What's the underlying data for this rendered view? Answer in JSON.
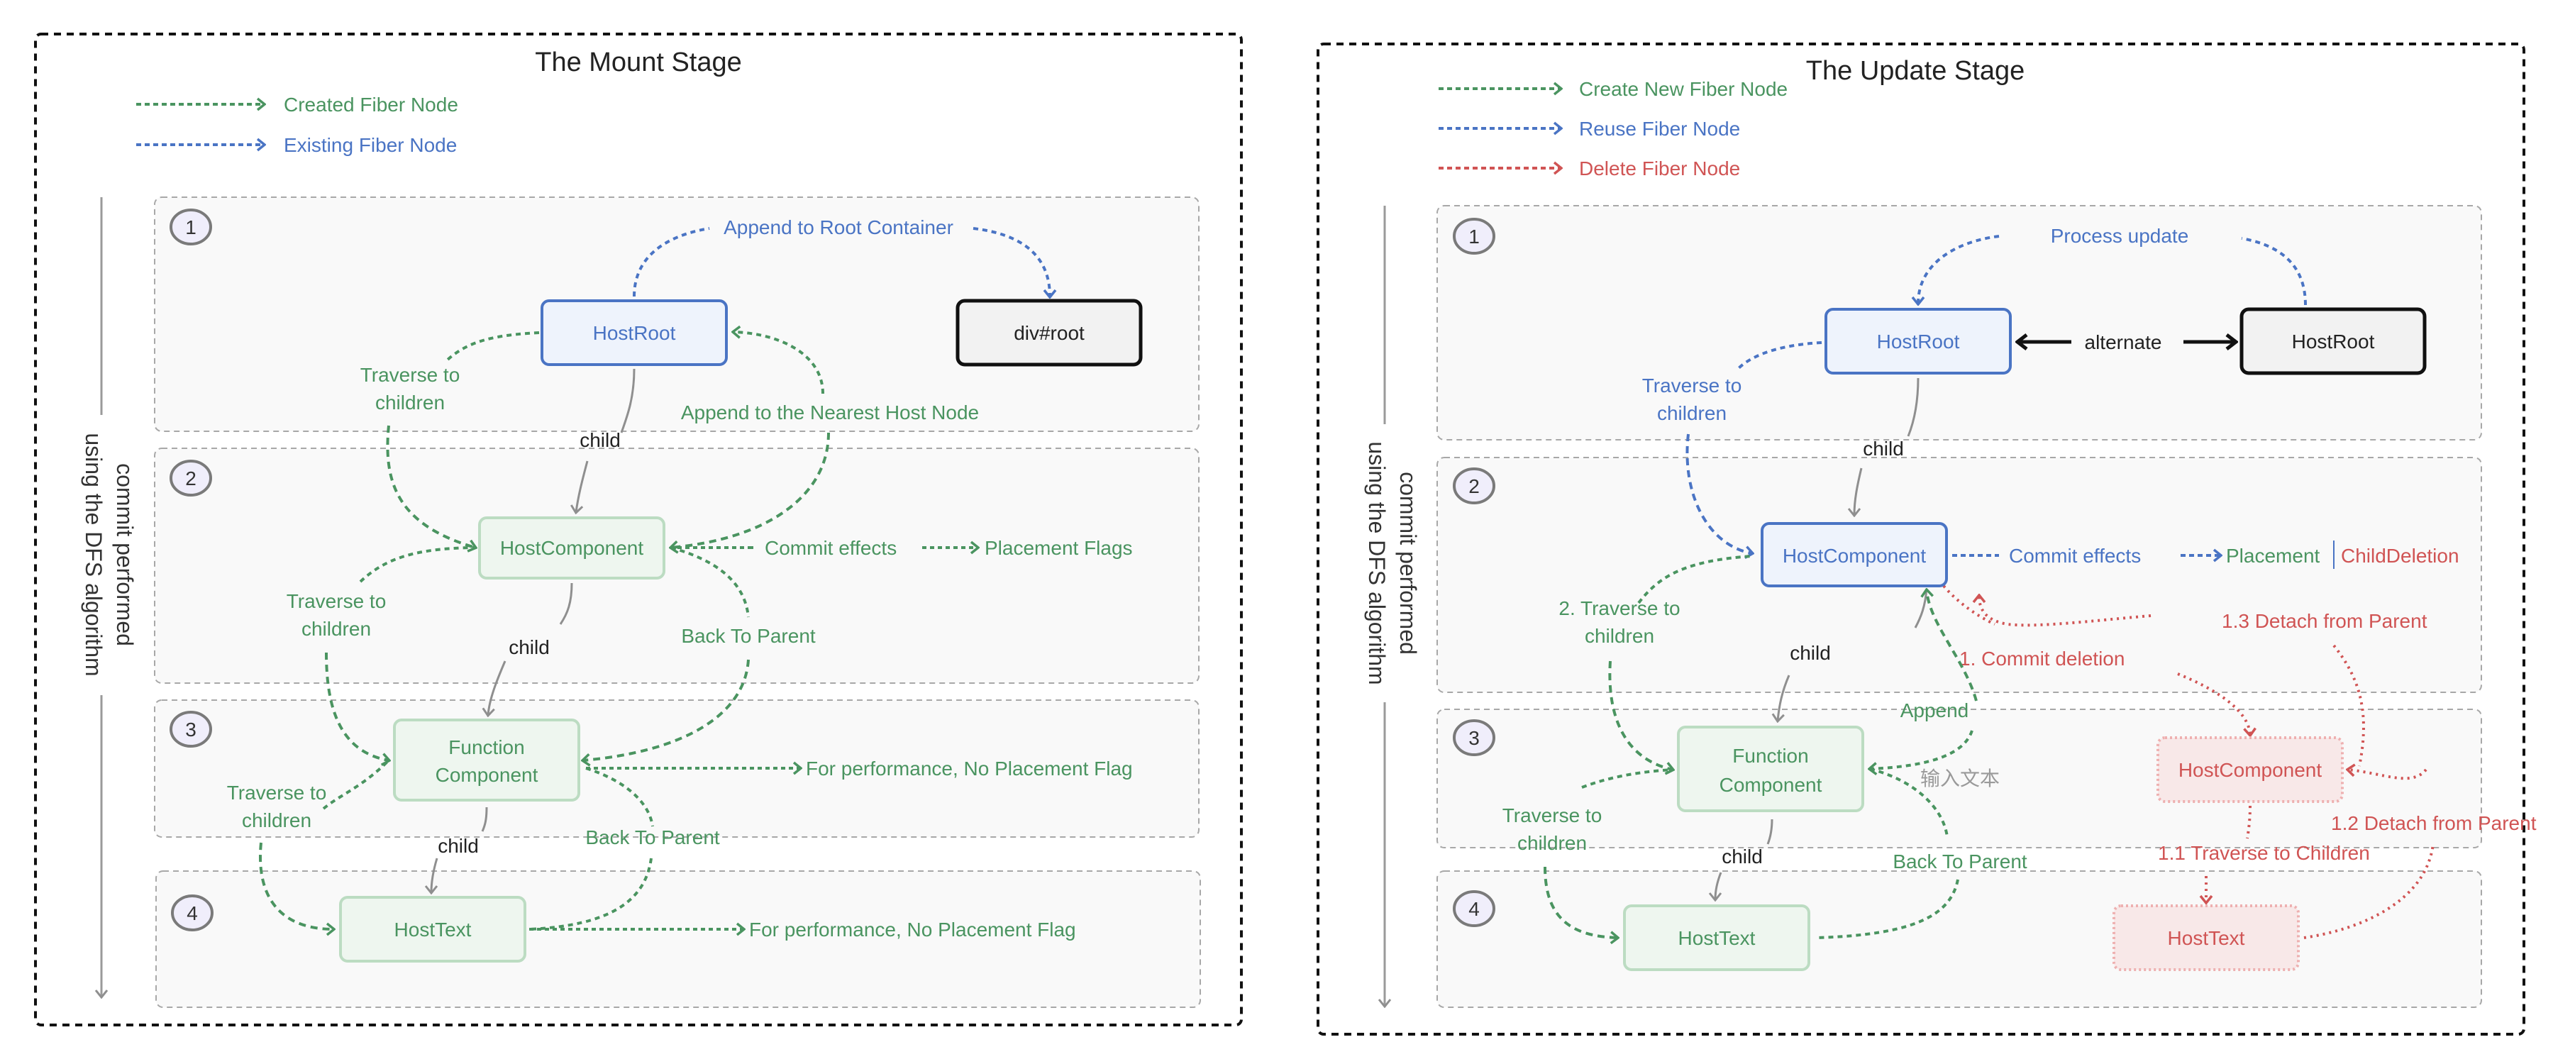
{
  "colors": {
    "create": "#4a9460",
    "reuse": "#4a74c4",
    "delete": "#d05454",
    "child": "#8f8f8f",
    "green_fill": "#eef6ef",
    "green_border": "#bcdcc2",
    "blue_fill": "#eef3fc",
    "blue_border": "#4a74c4",
    "red_fill": "#f8e8e8",
    "red_border": "#eeb0b0",
    "dark_fill": "#f2f2f2",
    "section_fill": "#f9f9f9"
  },
  "mount": {
    "title": "The Mount Stage",
    "legend": [
      {
        "label": "Created Fiber Node",
        "kind": "create"
      },
      {
        "label": "Existing Fiber Node",
        "kind": "reuse"
      }
    ],
    "axis_label": [
      "commit  performed",
      "using the DFS algorithm"
    ],
    "sections": [
      "1",
      "2",
      "3",
      "4"
    ],
    "nodes": {
      "hostroot": "HostRoot",
      "divroot": "div#root",
      "hostcomponent": "HostComponent",
      "function_component": [
        "Function",
        "Component"
      ],
      "hosttext": "HostText"
    },
    "labels": {
      "append_root": "Append to Root Container",
      "traverse1": [
        "Traverse to",
        "children"
      ],
      "append_nearest": "Append to the Nearest Host Node",
      "child1": "child",
      "commit_effects": "Commit effects",
      "placement_flags": "Placement Flags",
      "traverse2": [
        "Traverse to",
        "children"
      ],
      "child2": "child",
      "back_parent1": "Back To Parent",
      "no_flag1": "For performance, No Placement Flag",
      "traverse3": [
        "Traverse to",
        "children"
      ],
      "child3": "child",
      "back_parent2": "Back To Parent",
      "no_flag2": "For performance, No Placement Flag"
    }
  },
  "update": {
    "title": "The Update Stage",
    "legend": [
      {
        "label": "Create New Fiber Node",
        "kind": "create"
      },
      {
        "label": "Reuse Fiber Node",
        "kind": "reuse"
      },
      {
        "label": "Delete Fiber Node",
        "kind": "delete"
      }
    ],
    "axis_label": [
      "commit  performed",
      "using the DFS algorithm"
    ],
    "sections": [
      "1",
      "2",
      "3",
      "4"
    ],
    "nodes": {
      "hostroot_wip": "HostRoot",
      "hostroot_current": "HostRoot",
      "hostcomponent": "HostComponent",
      "function_component": [
        "Function",
        "Component"
      ],
      "hosttext": "HostText",
      "deleted_hostcomponent": "HostComponent",
      "deleted_hosttext": "HostText"
    },
    "labels": {
      "process_update": "Process update",
      "alternate": "alternate",
      "traverse1": [
        "Traverse to",
        "children"
      ],
      "child1": "child",
      "commit_effects": "Commit effects",
      "placement": "Placement",
      "separator": "|",
      "child_deletion": "ChildDeletion",
      "traverse2": [
        "2. Traverse to",
        "children"
      ],
      "detach_13": "1.3 Detach from Parent",
      "commit_deletion": "1. Commit deletion",
      "child2": "child",
      "append": "Append",
      "input_text": "输入文本",
      "detach_12": "1.2 Detach from Parent",
      "traverse3": [
        "Traverse to",
        "children"
      ],
      "traverse_children_11": "1.1 Traverse to Children",
      "child3": "child",
      "back_parent": "Back To Parent"
    }
  }
}
